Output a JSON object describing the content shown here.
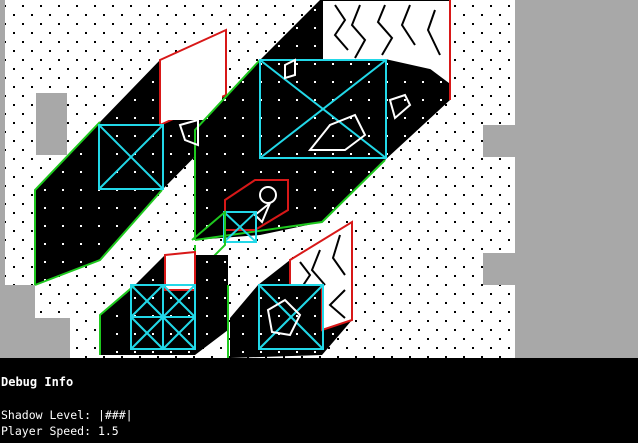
{
  "debug": {
    "title": "Debug Info",
    "shadow_label": "Shadow Level:",
    "shadow_value": "|###|",
    "speed_label": "Player Speed:",
    "speed_value": "1.5"
  },
  "colors": {
    "background": "#a8a8a8",
    "floor": "#ffffff",
    "wall": "#000000",
    "outline_red": "#d81818",
    "outline_green": "#1ec81e",
    "outline_cyan": "#22d8e8",
    "panel": "#000000"
  }
}
